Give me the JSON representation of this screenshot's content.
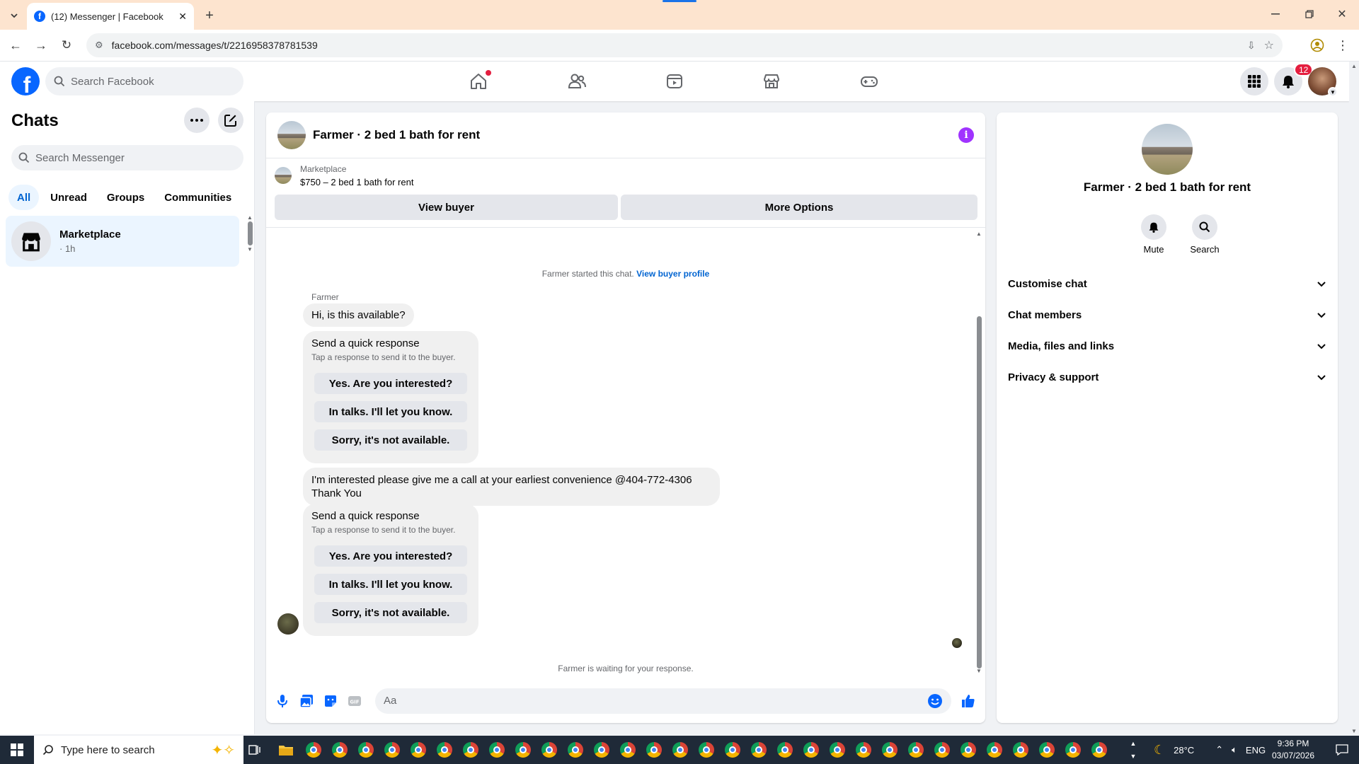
{
  "browser": {
    "tab_title": "(12) Messenger | Facebook",
    "url": "facebook.com/messages/t/2216958378781539"
  },
  "header": {
    "search_placeholder": "Search Facebook",
    "notification_count": "12",
    "nav_icons": [
      "home-icon",
      "friends-icon",
      "video-icon",
      "marketplace-icon",
      "gaming-icon"
    ]
  },
  "sidebar": {
    "title": "Chats",
    "search_placeholder": "Search Messenger",
    "filters": [
      "All",
      "Unread",
      "Groups",
      "Communities"
    ],
    "active_filter": "All",
    "chats": [
      {
        "name": "Marketplace",
        "time": "· 1h"
      }
    ]
  },
  "conversation": {
    "title": "Farmer · 2 bed 1 bath for rent",
    "marketplace_label": "Marketplace",
    "listing": "$750 – 2 bed 1 bath for rent",
    "view_buyer": "View buyer",
    "more_options": "More Options",
    "system_start": "Farmer started this chat.",
    "system_link": "View buyer profile",
    "sender": "Farmer",
    "message1": "Hi, is this available?",
    "quick_response_title": "Send a quick response",
    "quick_response_sub": "Tap a response to send it to the buyer.",
    "quick_options": [
      "Yes. Are you interested?",
      "In talks. I'll let you know.",
      "Sorry, it's not available."
    ],
    "message2_line1": "I'm interested please give me a call at your earliest convenience @404-772-4306",
    "message2_line2": "Thank You",
    "waiting": "Farmer is waiting for your response.",
    "composer_placeholder": "Aa"
  },
  "details": {
    "name": "Farmer · 2 bed 1 bath for rent",
    "mute": "Mute",
    "search": "Search",
    "sections": [
      "Customise chat",
      "Chat members",
      "Media, files and links",
      "Privacy & support"
    ]
  },
  "taskbar": {
    "search_placeholder": "Type here to search",
    "weather": "28°C",
    "language": "ENG",
    "time": "9:36 PM",
    "date": "03/07/2026"
  },
  "colors": {
    "accent": "#0866ff",
    "active_bg": "#ebf5ff",
    "info_purple": "#a033ff",
    "badge_red": "#e41e3f"
  }
}
